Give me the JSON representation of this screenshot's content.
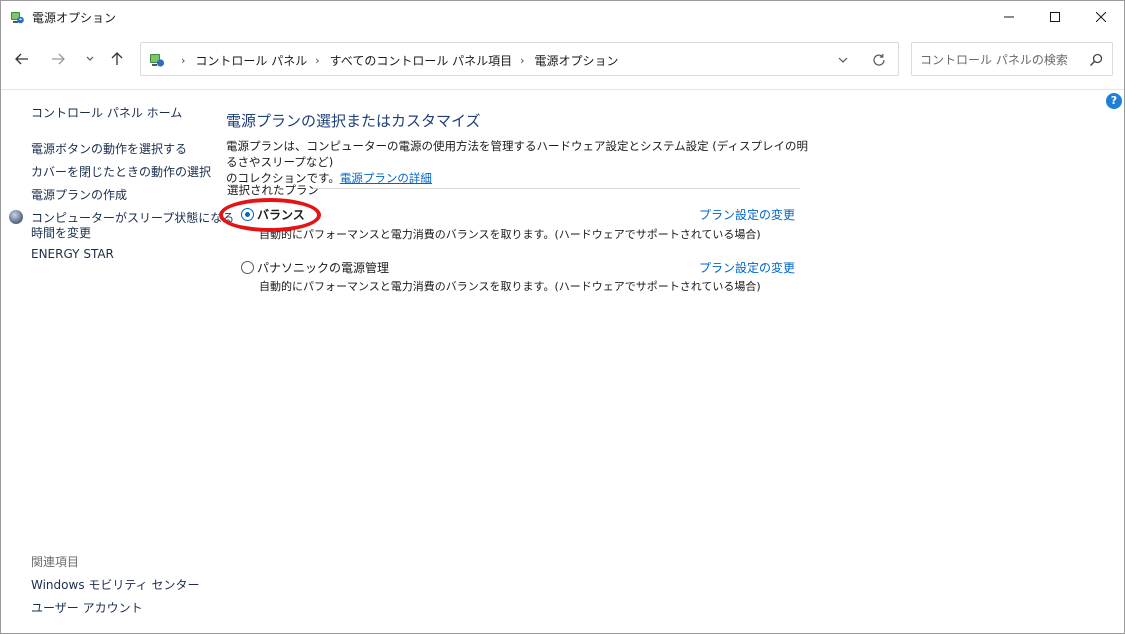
{
  "window": {
    "title": "電源オプション",
    "min_label": "minimize",
    "max_label": "maximize",
    "close_label": "close"
  },
  "nav": {
    "breadcrumbs": [
      "コントロール パネル",
      "すべてのコントロール パネル項目",
      "電源オプション"
    ],
    "search_placeholder": "コントロール パネルの検索"
  },
  "sidebar": {
    "home": "コントロール パネル ホーム",
    "links": [
      "電源ボタンの動作を選択する",
      "カバーを閉じたときの動作の選択",
      "電源プランの作成",
      "コンピューターがスリープ状態になる",
      "時間を変更",
      "ENERGY STAR"
    ],
    "related_heading": "関連項目",
    "related": [
      "Windows モビリティ センター",
      "ユーザー アカウント"
    ]
  },
  "main": {
    "title": "電源プランの選択またはカスタマイズ",
    "desc_line1": "電源プランは、コンピューターの電源の使用方法を管理するハードウェア設定とシステム設定 (ディスプレイの明るさやスリープなど)",
    "desc_line2": "のコレクションです。",
    "desc_link": "電源プランの詳細",
    "group_label": "選択されたプラン",
    "plans": [
      {
        "name": "バランス",
        "selected": true,
        "desc": "自動的にパフォーマンスと電力消費のバランスを取ります。(ハードウェアでサポートされている場合)",
        "link": "プラン設定の変更"
      },
      {
        "name": "パナソニックの電源管理",
        "selected": false,
        "desc": "自動的にパフォーマンスと電力消費のバランスを取ります。(ハードウェアでサポートされている場合)",
        "link": "プラン設定の変更"
      }
    ]
  },
  "help": {
    "label": "?"
  },
  "colors": {
    "link": "#0066cc",
    "title": "#1e3f7a",
    "highlight": "#e41414",
    "radio": "#0067c0"
  }
}
